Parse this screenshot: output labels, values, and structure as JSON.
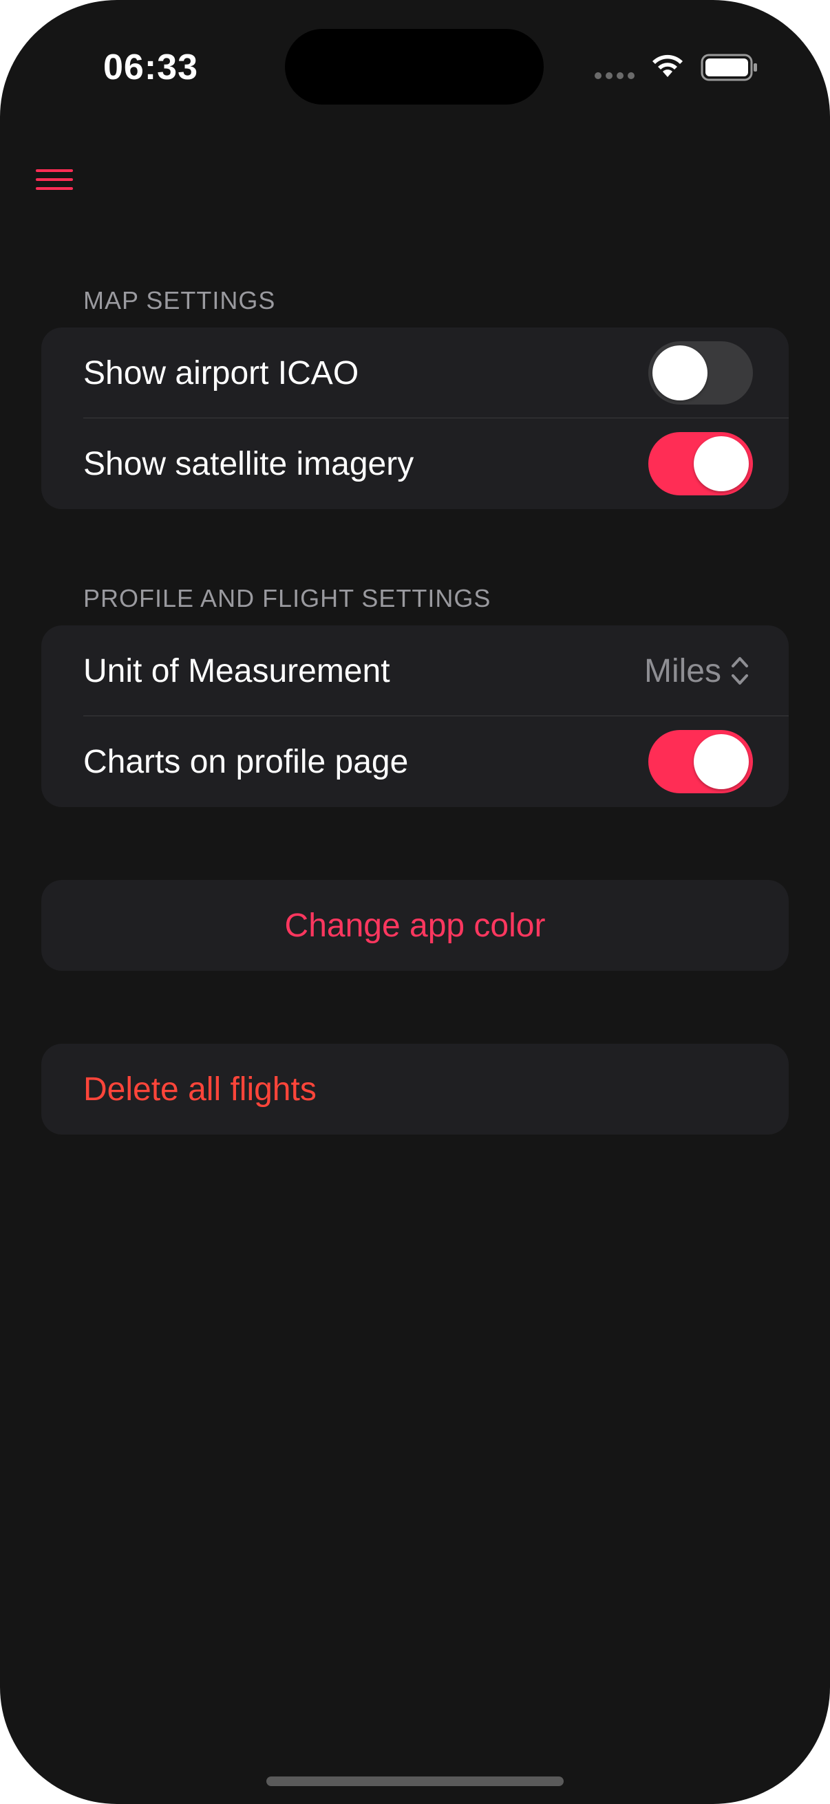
{
  "status_bar": {
    "time": "06:33",
    "wifi_icon": "wifi-icon",
    "battery_icon": "battery-icon"
  },
  "nav": {
    "menu_icon": "hamburger-menu-icon"
  },
  "accent_color": "#ff2d55",
  "destructive_color": "#ff453a",
  "map_settings": {
    "header": "MAP SETTINGS",
    "items": [
      {
        "label": "Show airport ICAO",
        "toggle_on": false
      },
      {
        "label": "Show satellite imagery",
        "toggle_on": true
      }
    ]
  },
  "profile_settings": {
    "header": "PROFILE AND FLIGHT SETTINGS",
    "unit_label": "Unit of Measurement",
    "unit_value": "Miles",
    "charts_label": "Charts on profile page",
    "charts_toggle_on": true
  },
  "actions": {
    "change_color": "Change app color",
    "delete_flights": "Delete all flights"
  }
}
